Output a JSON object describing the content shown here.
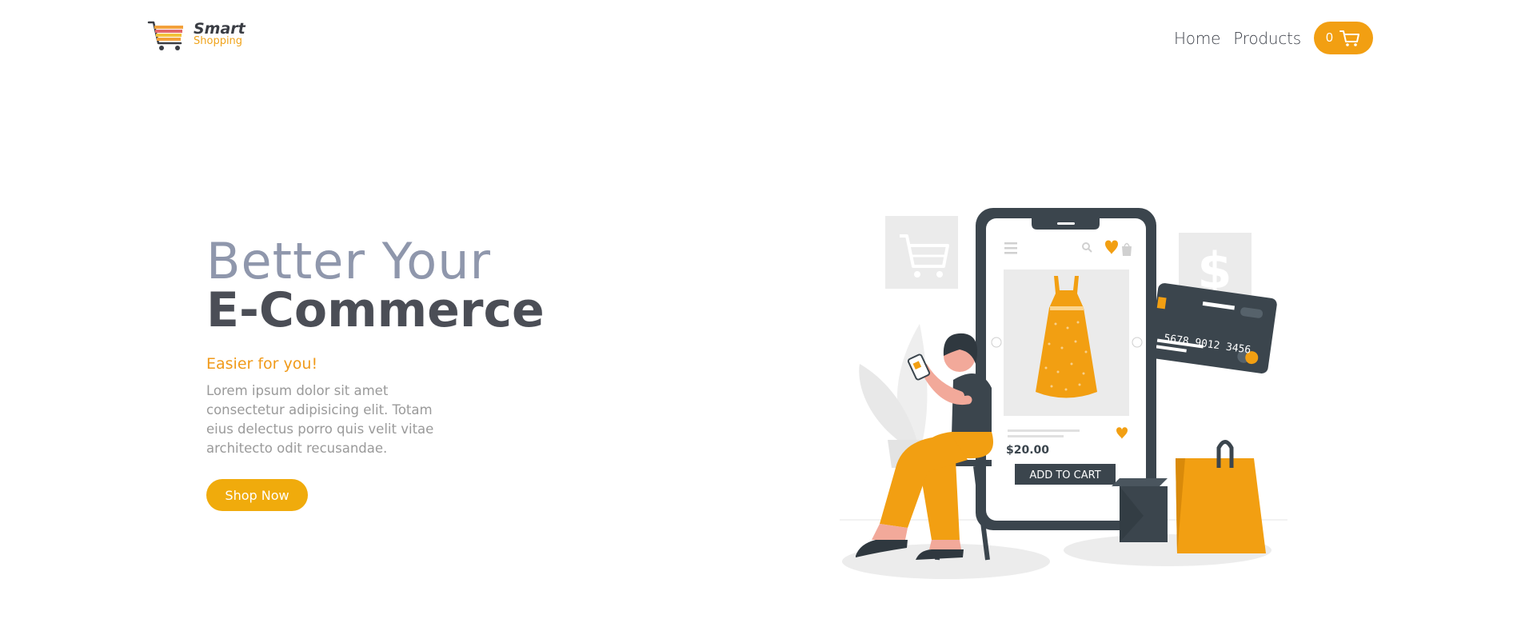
{
  "header": {
    "brand_main": "Smart",
    "brand_sub": "Shopping",
    "nav": [
      {
        "label": "Home"
      },
      {
        "label": "Products"
      }
    ],
    "cart_count": "0"
  },
  "hero": {
    "title_line1": "Better Your",
    "title_line2": "E-Commerce",
    "tagline": "Easier for you!",
    "description": "Lorem ipsum dolor sit amet consectetur adipisicing elit. Totam eius delectus porro quis velit vitae architecto odit recusandae.",
    "cta_label": "Shop Now"
  },
  "illustration": {
    "price": "$20.00",
    "add_to_cart": "ADD TO CART",
    "card_number": "5678  9012  3456"
  },
  "colors": {
    "accent": "#f29f12",
    "cta": "#f0ab0c",
    "title_light": "#8f97ac",
    "title_dark": "#4b4e56",
    "dark_slate": "#3b454d"
  },
  "icons": [
    "shopping-cart-logo-icon",
    "cart-icon",
    "shopping-cart-icon",
    "dollar-icon",
    "heart-icon",
    "search-icon",
    "menu-icon",
    "bag-icon"
  ]
}
